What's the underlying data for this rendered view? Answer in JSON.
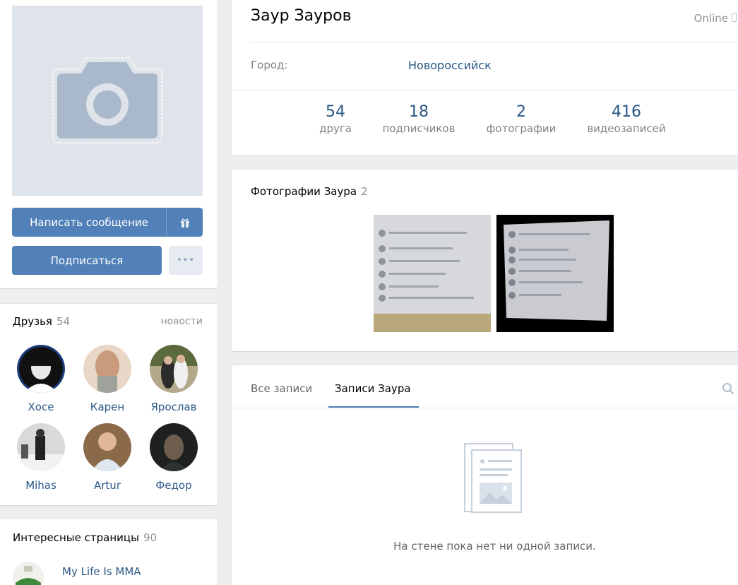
{
  "profile": {
    "name": "Заур Зауров",
    "status": "Online",
    "city_label": "Город:",
    "city_value": "Новороссийск"
  },
  "actions": {
    "message_label": "Написать сообщение",
    "subscribe_label": "Подписаться",
    "more_label": "•••"
  },
  "counters": [
    {
      "value": "54",
      "label": "друга"
    },
    {
      "value": "18",
      "label": "подписчиков"
    },
    {
      "value": "2",
      "label": "фотографии"
    },
    {
      "value": "416",
      "label": "видеозаписей"
    }
  ],
  "friends": {
    "title": "Друзья",
    "count": "54",
    "news_label": "новости",
    "items": [
      {
        "name": "Хосе"
      },
      {
        "name": "Карен"
      },
      {
        "name": "Ярослав"
      },
      {
        "name": "Mihas"
      },
      {
        "name": "Artur"
      },
      {
        "name": "Федор"
      }
    ]
  },
  "pages": {
    "title": "Интересные страницы",
    "count": "90",
    "items": [
      {
        "name": "My Life Is MMA"
      }
    ]
  },
  "photos": {
    "title": "Фотографии Заура",
    "count": "2"
  },
  "wall": {
    "tabs": [
      {
        "label": "Все записи"
      },
      {
        "label": "Записи Заура"
      }
    ],
    "empty_text": "На стене пока нет ни одной записи."
  },
  "colors": {
    "accent": "#5181b8",
    "link": "#2a5885",
    "muted": "#828282",
    "background": "#edeef0"
  },
  "icons": {
    "avatar_placeholder": "camera-icon",
    "gift": "gift-icon",
    "status": "phone-icon",
    "search": "search-icon",
    "empty_wall": "document-image-icon"
  }
}
